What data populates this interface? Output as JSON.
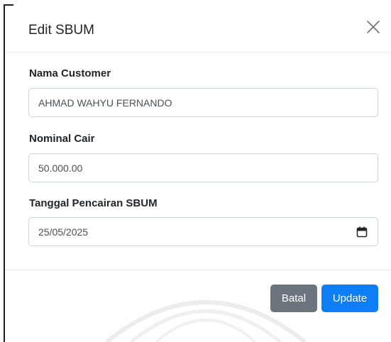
{
  "modal": {
    "title": "Edit SBUM",
    "close_icon": "close-icon"
  },
  "form": {
    "customer": {
      "label": "Nama Customer",
      "value": "AHMAD WAHYU FERNANDO"
    },
    "nominal": {
      "label": "Nominal Cair",
      "value": "50.000.00"
    },
    "tanggal": {
      "label": "Tanggal Pencairan SBUM",
      "value": "25/05/2025",
      "icon": "calendar-icon"
    }
  },
  "footer": {
    "cancel_label": "Batal",
    "update_label": "Update"
  },
  "colors": {
    "primary": "#0d7ef5",
    "secondary": "#6c757d"
  }
}
